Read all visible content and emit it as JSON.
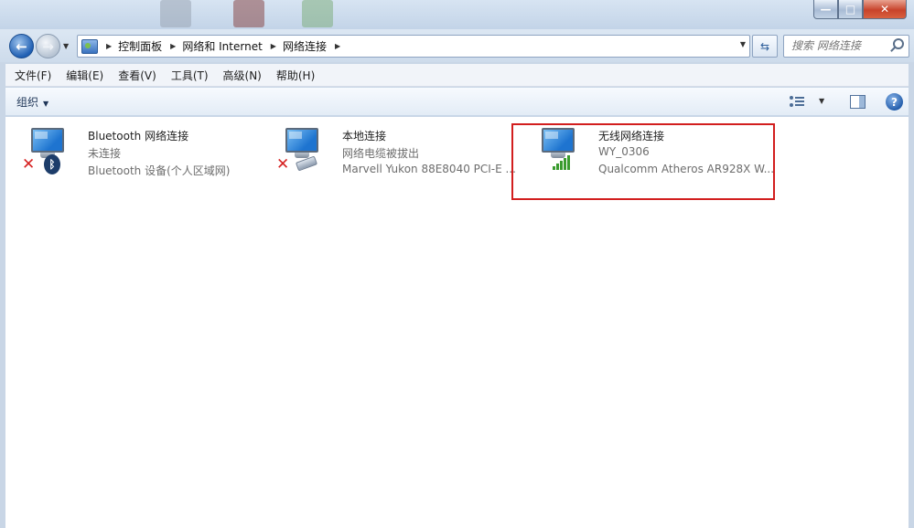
{
  "titlebar": {
    "minimize_glyph": "—",
    "maximize_glyph": "□",
    "close_glyph": "✕"
  },
  "nav": {
    "back_glyph": "←",
    "forward_glyph": "→"
  },
  "address": {
    "breadcrumbs": [
      "控制面板",
      "网络和 Internet",
      "网络连接"
    ]
  },
  "search": {
    "placeholder": "搜索 网络连接"
  },
  "menu": {
    "items": [
      "文件(F)",
      "编辑(E)",
      "查看(V)",
      "工具(T)",
      "高级(N)",
      "帮助(H)"
    ]
  },
  "toolbar": {
    "organize_label": "组织",
    "help_glyph": "?"
  },
  "connections": [
    {
      "name": "Bluetooth 网络连接",
      "status": "未连接",
      "device": "Bluetooth 设备(个人区域网)",
      "badge_icon": "bluetooth-icon",
      "disconnected": true
    },
    {
      "name": "本地连接",
      "status": "网络电缆被拔出",
      "device": "Marvell Yukon 88E8040 PCI-E ...",
      "badge_icon": "ethernet-cable-icon",
      "disconnected": true
    },
    {
      "name": "无线网络连接",
      "status": "WY_0306",
      "device": "Qualcomm Atheros AR928X W...",
      "badge_icon": "wifi-signal-icon",
      "disconnected": false,
      "highlighted": true
    }
  ],
  "colors": {
    "highlight_border": "#d21e1e",
    "disconnected_x": "#d62222",
    "signal_green": "#3a9b2e"
  }
}
